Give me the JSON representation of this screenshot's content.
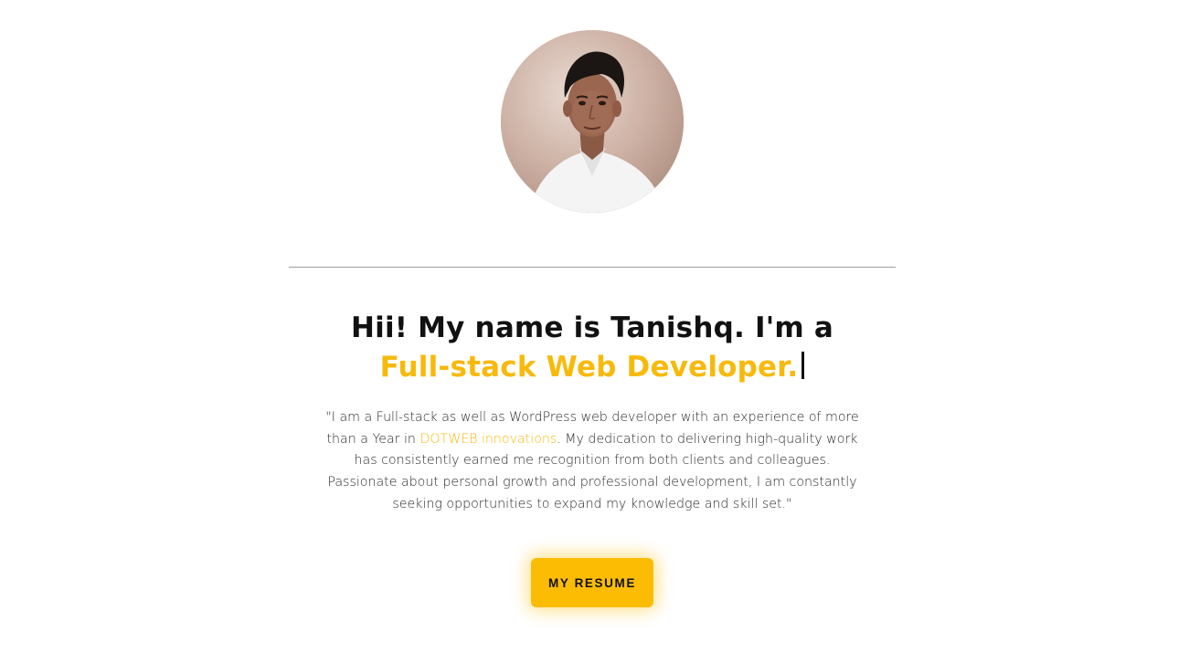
{
  "profile": {
    "avatar_alt": "Profile photo"
  },
  "hero": {
    "headline_line1": "Hii! My name is Tanishq. I'm a",
    "headline_line2": "Full-stack Web Developer.",
    "bio_before": "\"I am a Full-stack as well as WordPress web developer with an experience of more than a Year in ",
    "bio_company": "DOTWEB innovations",
    "bio_after": ". My dedication to delivering high-quality work has consistently earned me recognition from both clients and colleagues. Passionate about personal growth and professional development, I am constantly seeking opportunities to expand my knowledge and skill set.\""
  },
  "actions": {
    "resume_label": "MY RESUME"
  },
  "colors": {
    "accent": "#f7b90b",
    "button": "#fcbc04",
    "text": "#111111",
    "divider": "#9e9e9e"
  }
}
